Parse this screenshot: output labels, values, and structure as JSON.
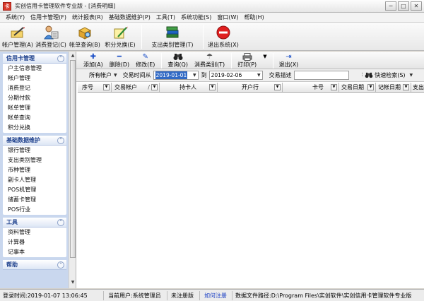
{
  "window": {
    "title": "实创信用卡管理软件专业版 - [消费明细]",
    "app_icon": "卡",
    "buttons": {
      "minimize": "─",
      "maximize": "□",
      "close": "✕"
    }
  },
  "menubar": [
    "系统(Y)",
    "信用卡管理(F)",
    "统计报表(R)",
    "基础数据维护(P)",
    "工具(T)",
    "系统功能(S)",
    "窗口(W)",
    "帮助(H)"
  ],
  "main_toolbar": [
    {
      "label": "帐户管理(A)",
      "icon": "pen-card-icon"
    },
    {
      "label": "消费登记(C)",
      "icon": "person-register-icon"
    },
    {
      "label": "帐单查询(B)",
      "icon": "box-search-icon"
    },
    {
      "label": "积分兑换(E)",
      "icon": "points-exchange-icon"
    },
    {
      "label": "支出类别管理(T)",
      "icon": "books-icon"
    },
    {
      "label": "退出系统(X)",
      "icon": "stop-icon"
    }
  ],
  "left_panel": [
    {
      "title": "信用卡管理",
      "items": [
        "户主信息管理",
        "帐户管理",
        "消费登记",
        "分期付款",
        "帐单管理",
        "帐单查询",
        "积分兑换"
      ]
    },
    {
      "title": "基础数据维护",
      "items": [
        "银行管理",
        "支出类别管理",
        "币种管理",
        "副卡人管理",
        "POS机管理",
        "储蓄卡管理",
        "POS行业"
      ]
    },
    {
      "title": "工具",
      "items": [
        "资料管理",
        "计算器",
        "记事本"
      ]
    },
    {
      "title": "帮助",
      "items": []
    }
  ],
  "secondary_toolbar": [
    {
      "label": "添加(A)",
      "icon": "add-icon",
      "glyph": "✚",
      "color": "#1b4fc7"
    },
    {
      "label": "删除(D)",
      "icon": "delete-icon",
      "glyph": "━",
      "color": "#1b4fc7"
    },
    {
      "label": "修改(E)",
      "icon": "edit-icon",
      "glyph": "✎",
      "color": "#1b4fc7"
    },
    {
      "label": "查询(Q)",
      "icon": "binoculars-icon",
      "glyph": "⛶",
      "color": "#222222"
    },
    {
      "label": "消费类别(T)",
      "icon": "category-icon",
      "glyph": "☂",
      "color": "#555555"
    },
    {
      "label": "打印(P)",
      "icon": "printer-icon",
      "glyph": "⎙",
      "color": "#333333"
    },
    {
      "label": "退出(X)",
      "icon": "exit-icon",
      "glyph": "⇥",
      "color": "#1b4fc7"
    }
  ],
  "filter": {
    "account_select": "所有帐户",
    "date_from_label": "交易时间从",
    "date_from": "2019-01-01",
    "to_label": "到",
    "date_to": "2019-02-06",
    "desc_label": "交易描述",
    "desc_value": "",
    "quick_search_label": "快速检索(S)",
    "quick_search_icon": "binoculars-icon"
  },
  "grid": {
    "columns": [
      "序号",
      "交易帐户",
      "/",
      "持卡人",
      "开户行",
      "卡号",
      "交易日期",
      "记帐日期",
      "支出"
    ],
    "rows": []
  },
  "status": {
    "login_time": "登录时间:2019-01-07 13:06:45",
    "current_user": "当前用户:系统管理员",
    "registration": "未注册版",
    "register_link": "如何注册",
    "data_path": "数据文件路径:D:\\Program Files\\实创软件\\实创信用卡管理软件专业版"
  },
  "colors": {
    "accent": "#316ac5",
    "left_panel_bg": "#c9d7ee",
    "group_title": "#1c3f8c",
    "link": "#1a3fc4"
  }
}
